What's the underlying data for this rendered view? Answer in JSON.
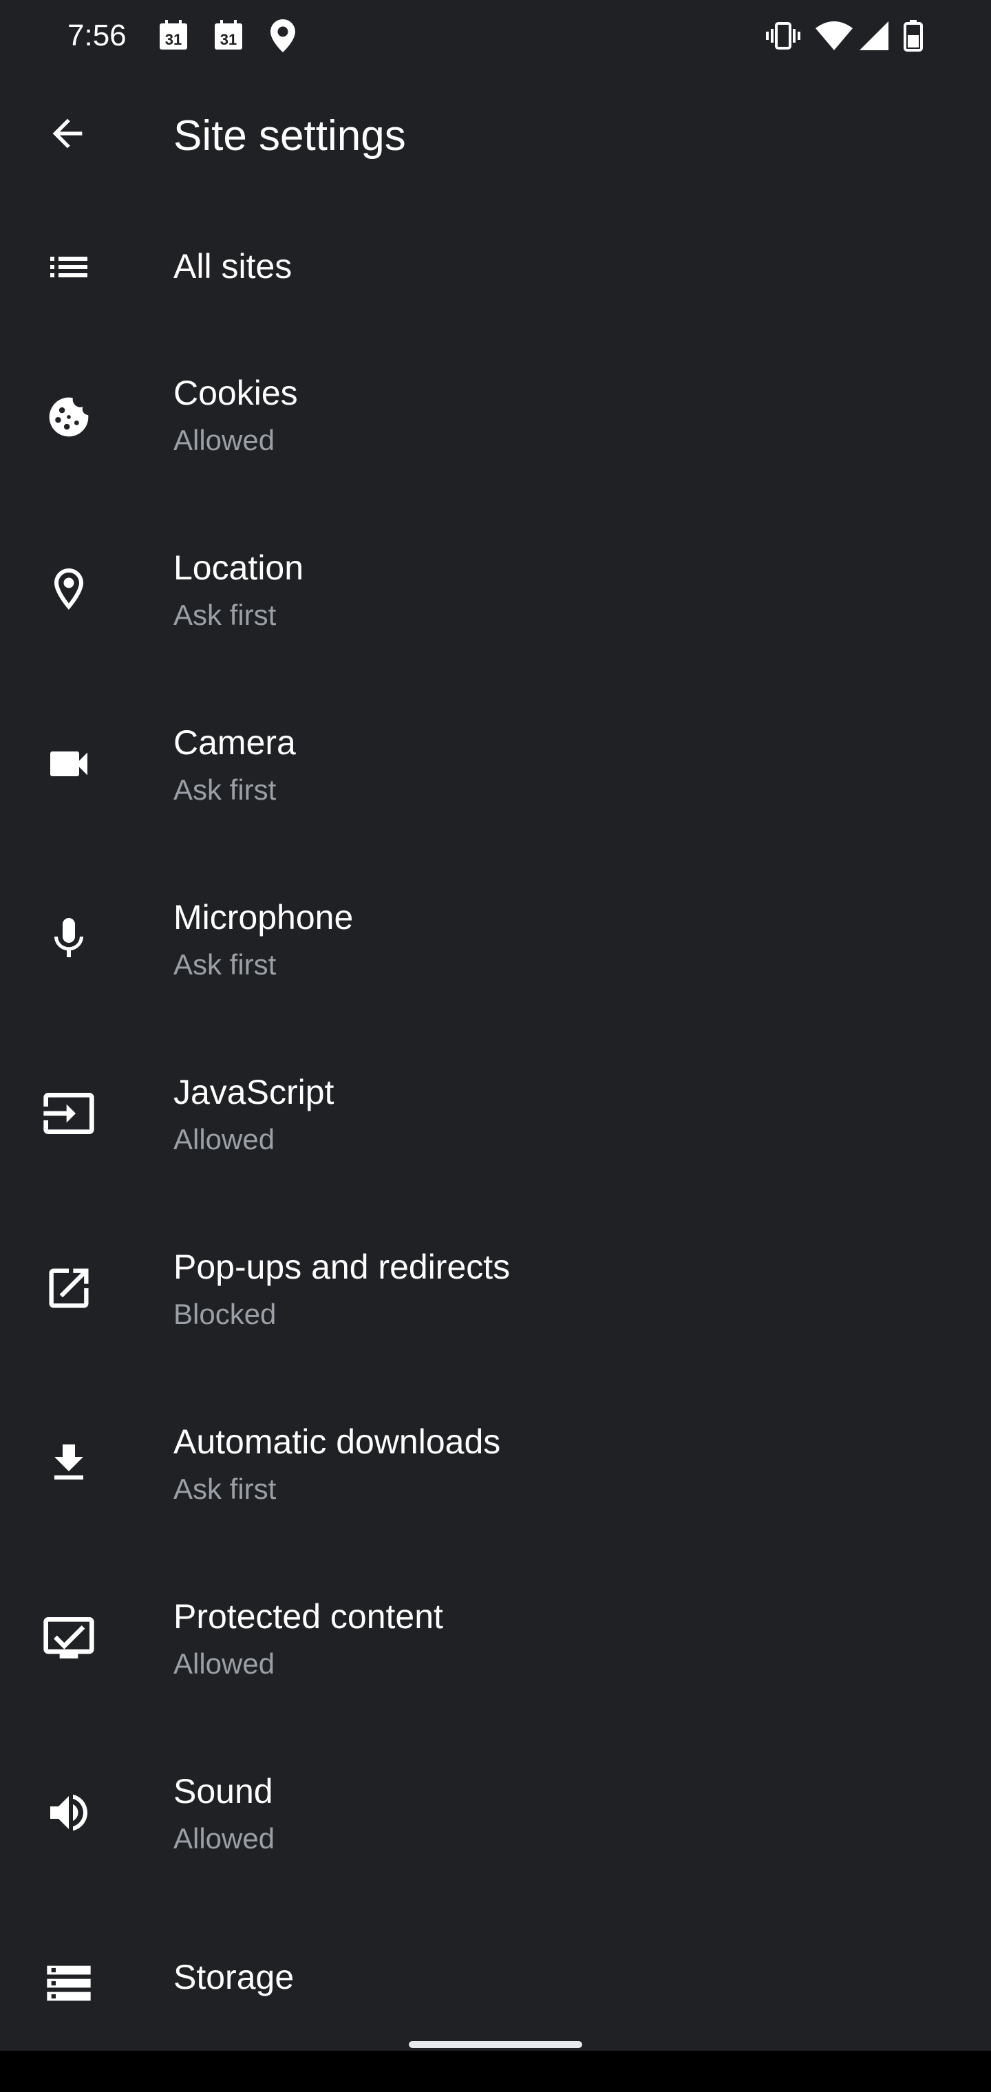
{
  "status_bar": {
    "time": "7:56",
    "calendar_day_1": "31",
    "calendar_day_2": "31",
    "icons": [
      "calendar-icon",
      "calendar-icon",
      "location-pin-icon",
      "vibrate-icon",
      "wifi-icon",
      "signal-icon",
      "battery-icon"
    ]
  },
  "app_bar": {
    "title": "Site settings",
    "back_icon": "arrow-back-icon"
  },
  "items": [
    {
      "id": "all-sites",
      "title": "All sites",
      "subtitle": "",
      "icon": "list-icon"
    },
    {
      "id": "cookies",
      "title": "Cookies",
      "subtitle": "Allowed",
      "icon": "cookie-icon"
    },
    {
      "id": "location",
      "title": "Location",
      "subtitle": "Ask first",
      "icon": "location-icon"
    },
    {
      "id": "camera",
      "title": "Camera",
      "subtitle": "Ask first",
      "icon": "videocam-icon"
    },
    {
      "id": "microphone",
      "title": "Microphone",
      "subtitle": "Ask first",
      "icon": "mic-icon"
    },
    {
      "id": "javascript",
      "title": "JavaScript",
      "subtitle": "Allowed",
      "icon": "input-icon"
    },
    {
      "id": "popups",
      "title": "Pop-ups and redirects",
      "subtitle": "Blocked",
      "icon": "open-in-new-icon"
    },
    {
      "id": "downloads",
      "title": "Automatic downloads",
      "subtitle": "Ask first",
      "icon": "download-icon"
    },
    {
      "id": "protected",
      "title": "Protected content",
      "subtitle": "Allowed",
      "icon": "screen-check-icon"
    },
    {
      "id": "sound",
      "title": "Sound",
      "subtitle": "Allowed",
      "icon": "volume-icon"
    },
    {
      "id": "storage",
      "title": "Storage",
      "subtitle": "",
      "icon": "storage-icon"
    }
  ],
  "colors": {
    "background": "#202125",
    "text_primary": "#ffffff",
    "text_secondary": "#9aa0a6",
    "nav_bar": "#000000"
  }
}
